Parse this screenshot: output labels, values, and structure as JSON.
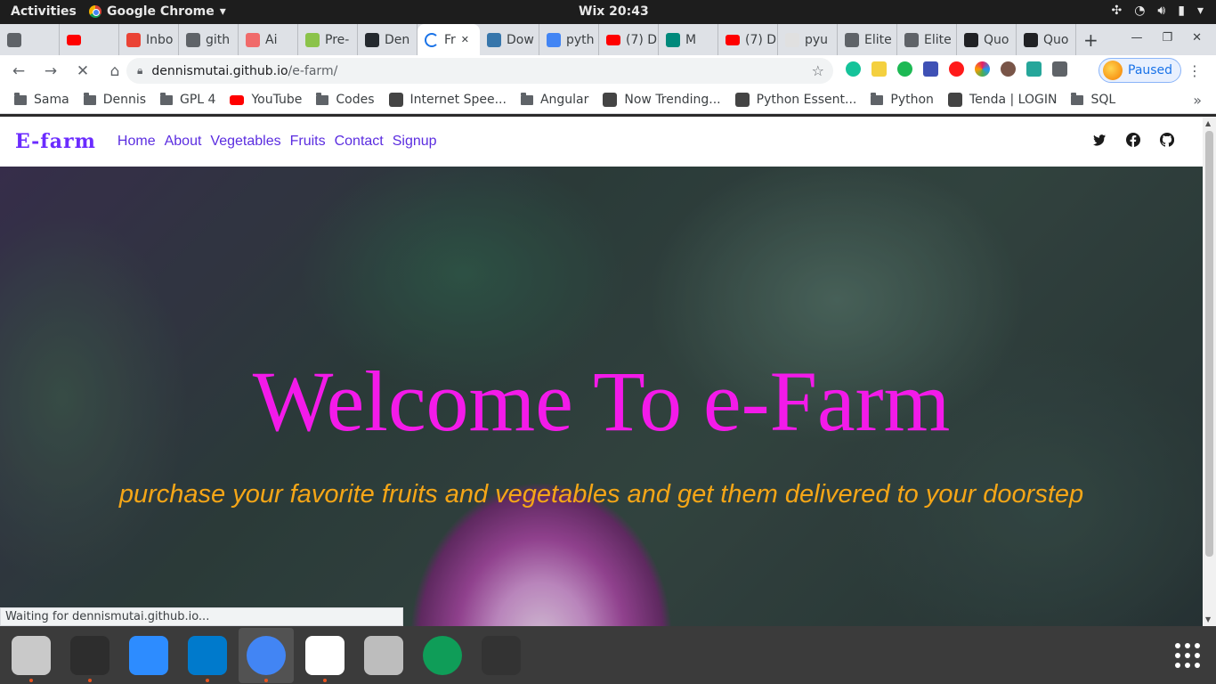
{
  "system": {
    "activities": "Activities",
    "app_menu": "Google Chrome",
    "clock": "Wix 20:43"
  },
  "tabs": [
    {
      "label": "",
      "icon": "clipboard-icon",
      "color": "#5f6368"
    },
    {
      "label": "",
      "icon": "youtube-icon",
      "color": "#ff0000"
    },
    {
      "label": "Inbo",
      "icon": "gmail-icon",
      "color": "#ea4335"
    },
    {
      "label": "gith",
      "icon": "globe-icon",
      "color": "#5f6368"
    },
    {
      "label": "Ai",
      "icon": "asana-icon",
      "color": "#f06a6a"
    },
    {
      "label": "Pre-",
      "icon": "tree-icon",
      "color": "#8bc34a"
    },
    {
      "label": "Den",
      "icon": "github-icon",
      "color": "#24292e"
    },
    {
      "label": "Fr",
      "icon": "loading-spinner-icon",
      "color": "#1a73e8",
      "active": true
    },
    {
      "label": "Dow",
      "icon": "python-icon",
      "color": "#3776ab"
    },
    {
      "label": "pyth",
      "icon": "google-icon",
      "color": "#4285f4"
    },
    {
      "label": "(7) D",
      "icon": "youtube-icon",
      "color": "#ff0000"
    },
    {
      "label": "M",
      "icon": "meet-icon",
      "color": "#00897b"
    },
    {
      "label": "(7) D",
      "icon": "youtube-icon",
      "color": "#ff0000"
    },
    {
      "label": "pyu",
      "icon": "page-icon",
      "color": "#e0e0e0"
    },
    {
      "label": "Elite",
      "icon": "globe-icon",
      "color": "#5f6368"
    },
    {
      "label": "Elite",
      "icon": "globe-icon",
      "color": "#5f6368"
    },
    {
      "label": "Quo",
      "icon": "angular-icon",
      "color": "#202124"
    },
    {
      "label": "Quo",
      "icon": "angular-icon",
      "color": "#202124"
    }
  ],
  "url": {
    "domain": "dennismutai.github.io",
    "path": "/e-farm/"
  },
  "profile_label": "Paused",
  "bookmarks": [
    {
      "label": "Sama",
      "type": "folder"
    },
    {
      "label": "Dennis",
      "type": "folder"
    },
    {
      "label": "GPL 4",
      "type": "folder"
    },
    {
      "label": "YouTube",
      "type": "youtube"
    },
    {
      "label": "Codes",
      "type": "folder"
    },
    {
      "label": "Internet Spee...",
      "type": "site"
    },
    {
      "label": "Angular",
      "type": "folder"
    },
    {
      "label": "Now Trending...",
      "type": "site"
    },
    {
      "label": "Python Essent...",
      "type": "site"
    },
    {
      "label": "Python",
      "type": "folder"
    },
    {
      "label": "Tenda | LOGIN",
      "type": "site"
    },
    {
      "label": "SQL",
      "type": "folder"
    }
  ],
  "site": {
    "brand": "E-farm",
    "nav": [
      "Home",
      "About",
      "Vegetables",
      "Fruits",
      "Contact",
      "Signup"
    ],
    "social_icons": [
      "twitter-icon",
      "facebook-icon",
      "github-icon"
    ],
    "hero_title": "Welcome To e-Farm",
    "hero_subtitle": "purchase your favorite fruits and vegetables and get them delivered to your doorstep",
    "title_color": "#f31ae9",
    "subtitle_color": "#f5a617",
    "brand_color": "#6b2bff"
  },
  "status_text": "Waiting for dennismutai.github.io...",
  "dock": [
    {
      "name": "files-icon",
      "color": "#c9c9c9",
      "running": true
    },
    {
      "name": "terminal-icon",
      "color": "#2d2d2d",
      "running": true
    },
    {
      "name": "zoom-icon",
      "color": "#2d8cff",
      "running": false
    },
    {
      "name": "vscode-icon",
      "color": "#007acc",
      "running": true
    },
    {
      "name": "chrome-icon",
      "color": "#4285f4",
      "running": true
    },
    {
      "name": "slack-icon",
      "color": "#ffffff",
      "running": true
    },
    {
      "name": "camera-icon",
      "color": "#bdbdbd",
      "running": false
    },
    {
      "name": "hangouts-icon",
      "color": "#0f9d58",
      "running": false
    },
    {
      "name": "video-editor-icon",
      "color": "#333333",
      "running": false
    }
  ]
}
